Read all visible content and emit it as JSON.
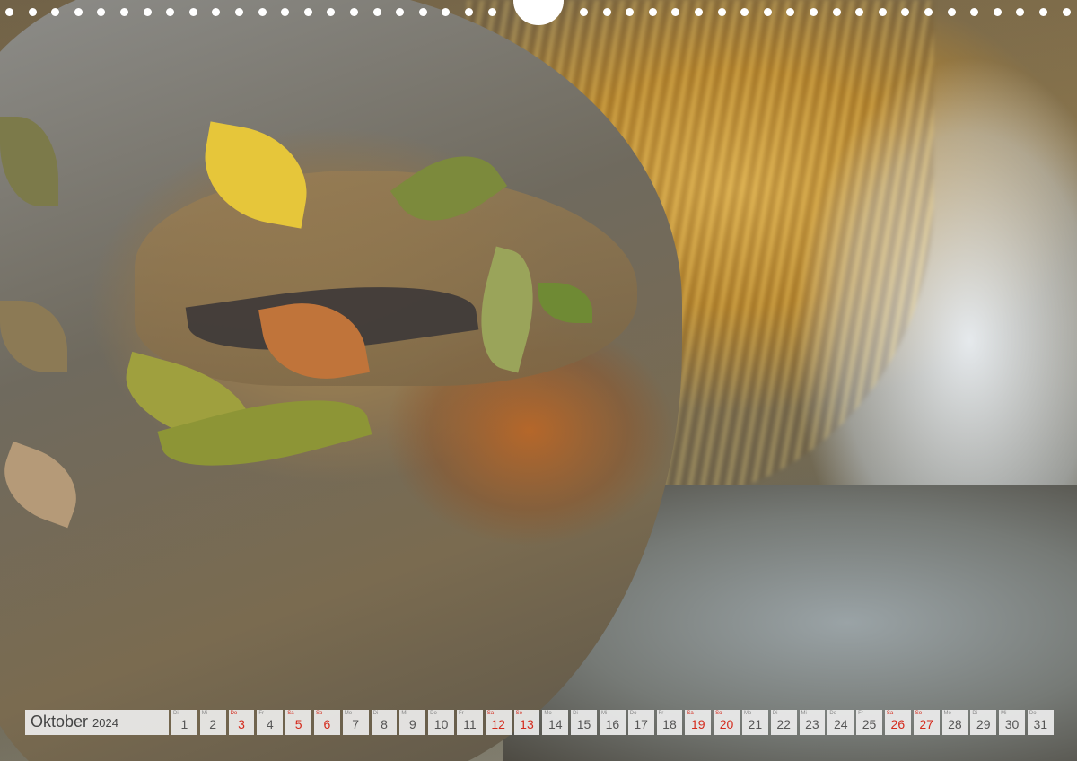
{
  "calendar": {
    "month": "Oktober",
    "year": "2024",
    "days": [
      {
        "wd": "Di",
        "d": "1",
        "red": false
      },
      {
        "wd": "Mi",
        "d": "2",
        "red": false
      },
      {
        "wd": "Do",
        "d": "3",
        "red": true
      },
      {
        "wd": "Fr",
        "d": "4",
        "red": false
      },
      {
        "wd": "Sa",
        "d": "5",
        "red": true
      },
      {
        "wd": "So",
        "d": "6",
        "red": true
      },
      {
        "wd": "Mo",
        "d": "7",
        "red": false
      },
      {
        "wd": "Di",
        "d": "8",
        "red": false
      },
      {
        "wd": "Mi",
        "d": "9",
        "red": false
      },
      {
        "wd": "Do",
        "d": "10",
        "red": false
      },
      {
        "wd": "Fr",
        "d": "11",
        "red": false
      },
      {
        "wd": "Sa",
        "d": "12",
        "red": true
      },
      {
        "wd": "So",
        "d": "13",
        "red": true
      },
      {
        "wd": "Mo",
        "d": "14",
        "red": false
      },
      {
        "wd": "Di",
        "d": "15",
        "red": false
      },
      {
        "wd": "Mi",
        "d": "16",
        "red": false
      },
      {
        "wd": "Do",
        "d": "17",
        "red": false
      },
      {
        "wd": "Fr",
        "d": "18",
        "red": false
      },
      {
        "wd": "Sa",
        "d": "19",
        "red": true
      },
      {
        "wd": "So",
        "d": "20",
        "red": true
      },
      {
        "wd": "Mo",
        "d": "21",
        "red": false
      },
      {
        "wd": "Di",
        "d": "22",
        "red": false
      },
      {
        "wd": "Mi",
        "d": "23",
        "red": false
      },
      {
        "wd": "Do",
        "d": "24",
        "red": false
      },
      {
        "wd": "Fr",
        "d": "25",
        "red": false
      },
      {
        "wd": "Sa",
        "d": "26",
        "red": true
      },
      {
        "wd": "So",
        "d": "27",
        "red": true
      },
      {
        "wd": "Mo",
        "d": "28",
        "red": false
      },
      {
        "wd": "Di",
        "d": "29",
        "red": false
      },
      {
        "wd": "Mi",
        "d": "30",
        "red": false
      },
      {
        "wd": "Do",
        "d": "31",
        "red": false
      }
    ]
  },
  "colors": {
    "holiday": "#d42a1c",
    "cell_bg": "#f0f0f0"
  }
}
